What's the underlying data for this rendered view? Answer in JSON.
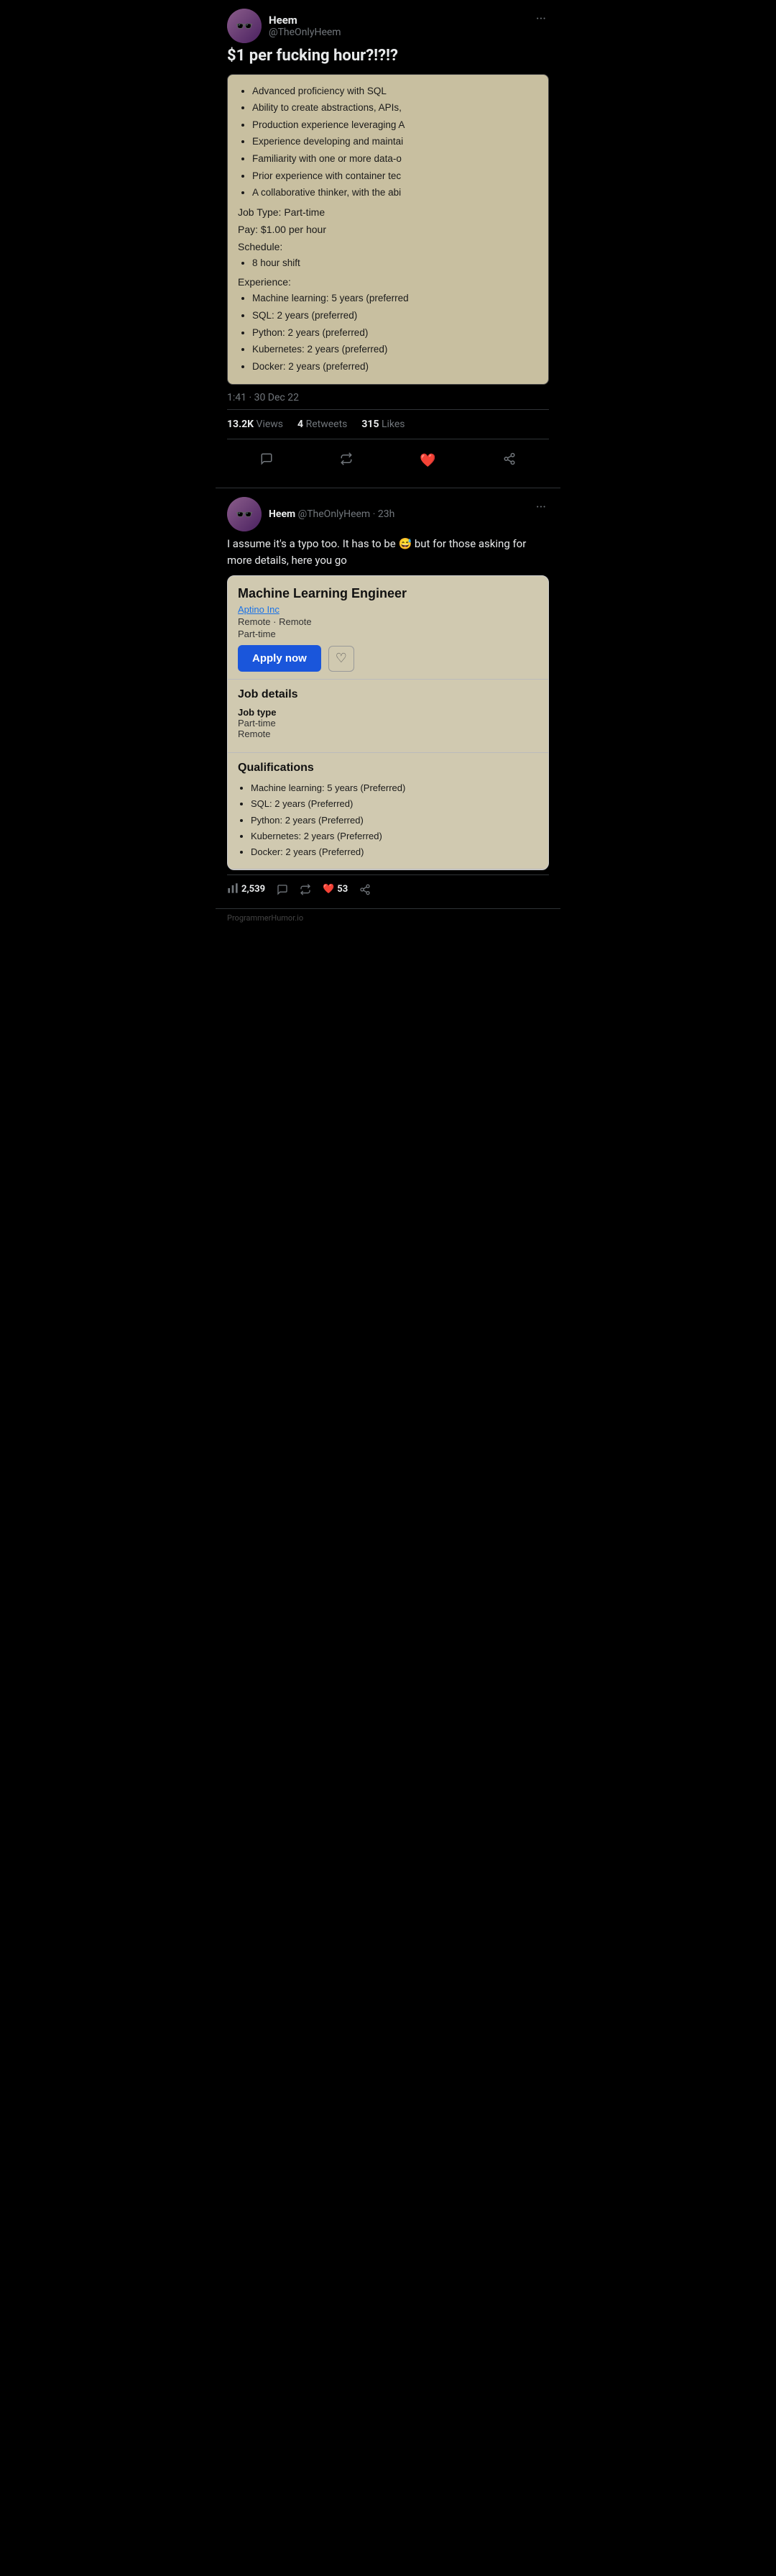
{
  "tweet1": {
    "user": {
      "display_name": "Heem",
      "username": "@TheOnlyHeem",
      "avatar_emoji": "🕶️"
    },
    "text": "$1 per fucking hour?!?!?",
    "screenshot": {
      "requirements": [
        "Advanced proficiency with SQL",
        "Ability to create abstractions, APIs,",
        "Production experience leveraging A",
        "Experience developing and maintai",
        "Familiarity with one or more data-o",
        "Prior experience with container tec",
        "A collaborative thinker, with the abi"
      ],
      "job_type_label": "Job Type:",
      "job_type_value": "Part-time",
      "pay_label": "Pay:",
      "pay_value": "$1.00 per hour",
      "schedule_label": "Schedule:",
      "schedule_items": [
        "8 hour shift"
      ],
      "experience_label": "Experience:",
      "experience_items": [
        "Machine learning: 5 years (preferred",
        "SQL: 2 years (preferred)",
        "Python: 2 years (preferred)",
        "Kubernetes: 2 years (preferred)",
        "Docker: 2 years (preferred)"
      ]
    },
    "timestamp": "1:41 · 30 Dec 22",
    "stats": {
      "views": "13.2K",
      "views_label": "Views",
      "retweets": "4",
      "retweets_label": "Retweets",
      "likes": "315",
      "likes_label": "Likes"
    },
    "actions": {
      "reply": "💬",
      "retweet": "🔁",
      "like": "❤️",
      "share": "📤"
    }
  },
  "tweet2": {
    "user": {
      "display_name": "Heem",
      "username": "@TheOnlyHeem",
      "timestamp": "23h",
      "avatar_emoji": "🕶️"
    },
    "text": "I assume it's a typo too. It has to be 😅 but for those asking for more details, here you go",
    "job_card": {
      "title": "Machine Learning Engineer",
      "company": "Aptino Inc",
      "location": "Remote · Remote",
      "type": "Part-time",
      "apply_label": "Apply now",
      "sections": {
        "job_details": {
          "title": "Job details",
          "job_type_label": "Job type",
          "job_type_values": [
            "Part-time",
            "Remote"
          ]
        },
        "qualifications": {
          "title": "Qualifications",
          "items": [
            "Machine learning: 5 years (Preferred)",
            "SQL: 2 years (Preferred)",
            "Python: 2 years (Preferred)",
            "Kubernetes: 2 years (Preferred)",
            "Docker: 2 years (Preferred)"
          ]
        }
      }
    },
    "stats": {
      "views": "2,539",
      "views_icon": "📊",
      "comments": "",
      "comments_icon": "💬",
      "retweets": "",
      "retweets_icon": "🔁",
      "likes": "53",
      "likes_icon": "❤️",
      "share_icon": "📤"
    }
  },
  "watermark": "ProgrammerHumor.io"
}
